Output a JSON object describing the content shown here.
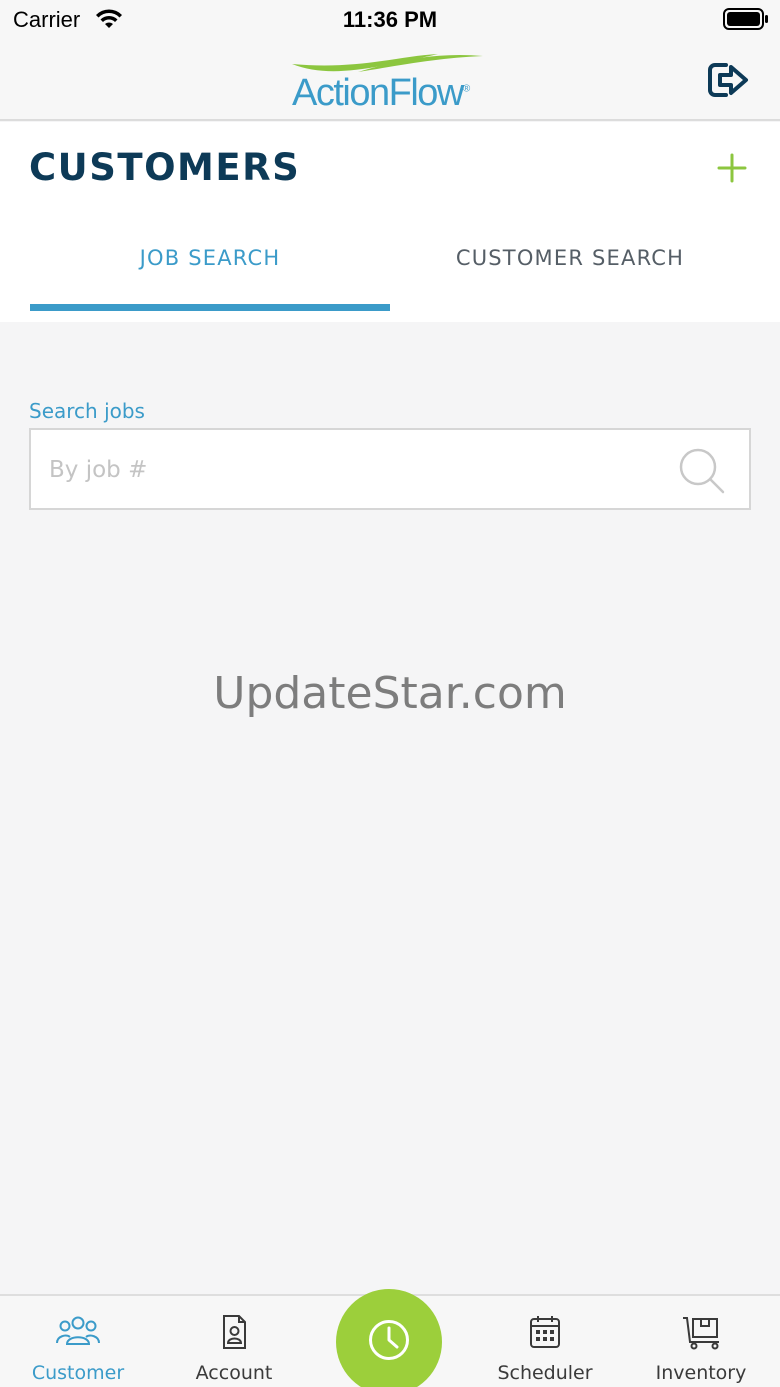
{
  "status_bar": {
    "carrier": "Carrier",
    "time": "11:36 PM"
  },
  "header": {
    "logo_text": "ActionFlow",
    "logo_mark": "®"
  },
  "page": {
    "title": "CUSTOMERS"
  },
  "tabs": [
    {
      "label": "JOB SEARCH",
      "active": true
    },
    {
      "label": "CUSTOMER SEARCH",
      "active": false
    }
  ],
  "search": {
    "label": "Search jobs",
    "placeholder": "By job #",
    "value": ""
  },
  "watermark": "UpdateStar.com",
  "bottom_nav": {
    "items": [
      {
        "label": "Customer",
        "icon": "users-icon",
        "active": true
      },
      {
        "label": "Account",
        "icon": "account-icon",
        "active": false
      },
      {
        "label": "Scheduler",
        "icon": "calendar-icon",
        "active": false
      },
      {
        "label": "Inventory",
        "icon": "inventory-icon",
        "active": false
      }
    ],
    "center_icon": "clock-icon"
  },
  "colors": {
    "accent": "#3b9bc9",
    "green": "#9ccf3b",
    "navy": "#0d3a57"
  }
}
